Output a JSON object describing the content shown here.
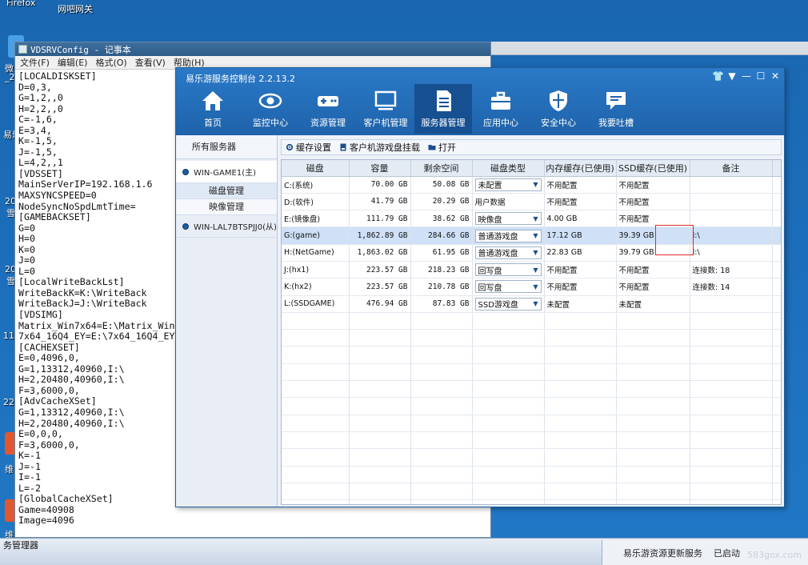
{
  "desktop": {
    "icons": [
      {
        "label": "Firefox"
      },
      {
        "label": "网吧网关"
      },
      {
        "label": "微"
      },
      {
        "label": "_20"
      },
      {
        "label": "易乐"
      },
      {
        "label": "20"
      },
      {
        "label": "雪"
      },
      {
        "label": "20"
      },
      {
        "label": "雪"
      },
      {
        "label": "111"
      },
      {
        "label": "222"
      },
      {
        "label": "维"
      },
      {
        "label": "维"
      }
    ],
    "taskbar_left_label": "务管理器"
  },
  "notepad": {
    "title": "VDSRVConfig - 记事本",
    "menu": [
      "文件(F)",
      "编辑(E)",
      "格式(O)",
      "查看(V)",
      "帮助(H)"
    ],
    "content": "[LOCALDISKSET]\nD=0,3,\nG=1,2,,0\nH=2,2,,0\nC=-1,6,\nE=3,4,\nK=-1,5,\nJ=-1,5,\nL=4,2,,1\n[VDSSET]\nMainSerVerIP=192.168.1.6\nMAXSYNCSPEED=0\nNodeSyncNoSpdLmtTime=\n[GAMEBACKSET]\nG=0\nH=0\nK=0\nJ=0\nL=0\n[LocalWriteBackLst]\nWriteBackK=K:\\WriteBack\nWriteBackJ=J:\\WriteBack\n[VDSIMG]\nMatrix_Win7x64=E:\\Matrix_Win7\n7x64_16Q4_EY=E:\\7x64_16Q4_EY\\\n[CACHEXSET]\nE=0,4096,0,\nG=1,13312,40960,I:\\\nH=2,20480,40960,I:\\\nF=3,6000,0,\n[AdvCacheXSet]\nG=1,13312,40960,I:\\\nH=2,20480,40960,I:\\\nE=0,0,0,\nF=3,6000,0,\nK=-1\nJ=-1\nI=-1\nL=-2\n[GlobalCacheXSet]\nGame=40908\nImage=4096"
  },
  "console": {
    "title": "易乐游服务控制台 2.2.13.2",
    "controls": [
      "👕",
      "▼",
      "—",
      "☐",
      "✕"
    ],
    "nav": [
      {
        "label": "首页",
        "icon": "home-icon"
      },
      {
        "label": "监控中心",
        "icon": "eye-icon"
      },
      {
        "label": "资源管理",
        "icon": "gamepad-icon"
      },
      {
        "label": "客户机管理",
        "icon": "monitor-icon"
      },
      {
        "label": "服务器管理",
        "icon": "server-doc-icon",
        "active": true
      },
      {
        "label": "应用中心",
        "icon": "toolbox-icon"
      },
      {
        "label": "安全中心",
        "icon": "shield-icon"
      },
      {
        "label": "我要吐槽",
        "icon": "chat-icon"
      }
    ],
    "sidebar": {
      "all_servers": "所有服务器",
      "server1": "WIN-GAME1(主)",
      "sub1": "磁盘管理",
      "sub2": "映像管理",
      "server2": "WIN-LAL7BTSPJJ0(从)"
    },
    "toolbar": [
      {
        "label": "缓存设置",
        "icon": "gear-icon"
      },
      {
        "label": "客户机游戏盘挂载",
        "icon": "disk-icon"
      },
      {
        "label": "打开",
        "icon": "folder-icon"
      }
    ],
    "table": {
      "headers": [
        "磁盘",
        "容量",
        "剩余空间",
        "磁盘类型",
        "内存缓存(已使用)",
        "SSD缓存(已使用)",
        "备注"
      ],
      "rows": [
        {
          "disk": "C:(系统)",
          "cap": "70.00 GB",
          "free": "50.08 GB",
          "type": "未配置",
          "dropdown": true,
          "mem": "不用配置",
          "ssd": "不用配置",
          "note": ""
        },
        {
          "disk": "D:(软件)",
          "cap": "41.79 GB",
          "free": "20.29 GB",
          "type": "用户数据",
          "dropdown": false,
          "mem": "不用配置",
          "ssd": "不用配置",
          "note": ""
        },
        {
          "disk": "E:(镜像盘)",
          "cap": "111.79 GB",
          "free": "38.62 GB",
          "type": "映像盘",
          "dropdown": true,
          "mem": "4.00 GB",
          "ssd": "不用配置",
          "note": ""
        },
        {
          "disk": "G:(game)",
          "cap": "1,862.89 GB",
          "free": "284.66 GB",
          "type": "普通游戏盘",
          "dropdown": true,
          "mem": "17.12 GB",
          "ssd": "39.39 GB",
          "ssd_path": "I:\\",
          "note": "",
          "selected": true
        },
        {
          "disk": "H:(NetGame)",
          "cap": "1,863.02 GB",
          "free": "61.95 GB",
          "type": "普通游戏盘",
          "dropdown": true,
          "mem": "22.83 GB",
          "ssd": "39.79 GB",
          "ssd_path": "I:\\",
          "note": ""
        },
        {
          "disk": "J:(hx1)",
          "cap": "223.57 GB",
          "free": "218.23 GB",
          "type": "回写盘",
          "dropdown": true,
          "mem": "不用配置",
          "ssd": "不用配置",
          "note": "连接数: 18"
        },
        {
          "disk": "K:(hx2)",
          "cap": "223.57 GB",
          "free": "210.78 GB",
          "type": "回写盘",
          "dropdown": true,
          "mem": "不用配置",
          "ssd": "不用配置",
          "note": "连接数: 14"
        },
        {
          "disk": "L:(SSDGAME)",
          "cap": "476.94 GB",
          "free": "87.83 GB",
          "type": "SSD游戏盘",
          "dropdown": true,
          "mem": "未配置",
          "ssd": "未配置",
          "note": ""
        }
      ],
      "empty_rows": 12
    }
  },
  "taskbar": {
    "task_label": "易乐游资源更新服务",
    "task_status": "已启动"
  },
  "watermark": "583gox.com"
}
